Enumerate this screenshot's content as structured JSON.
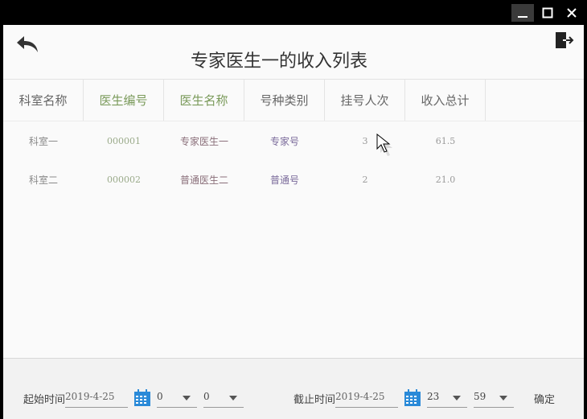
{
  "window": {
    "controls": [
      "minimize-icon",
      "maximize-icon",
      "close-icon"
    ]
  },
  "header": {
    "title": "专家医生一的收入列表",
    "back_icon": "back-arrow-icon",
    "exit_icon": "exit-icon"
  },
  "table": {
    "columns": [
      "科室名称",
      "医生编号",
      "医生名称",
      "号种类别",
      "挂号人次",
      "收入总计"
    ],
    "rows": [
      [
        "科室一",
        "000001",
        "专家医生一",
        "专家号",
        "3",
        "61.5"
      ],
      [
        "科室二",
        "000002",
        "普通医生二",
        "普通号",
        "2",
        "21.0"
      ]
    ]
  },
  "footer": {
    "start_label": "起始时间",
    "start_date": "2019-4-25",
    "start_hour": "0",
    "start_minute": "0",
    "end_label": "截止时间",
    "end_date": "2019-4-25",
    "end_hour": "23",
    "end_minute": "59",
    "confirm_label": "确定"
  },
  "colors": {
    "calendar": "#2a8ad8",
    "titlebar": "#000000"
  }
}
